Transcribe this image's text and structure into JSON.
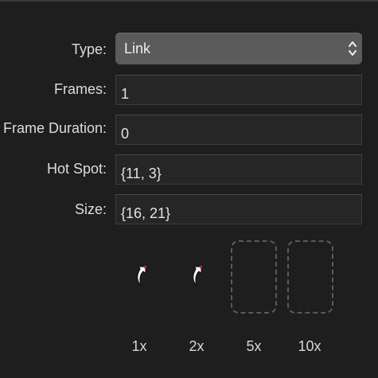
{
  "fields": {
    "type": {
      "label": "Type:",
      "value": "Link"
    },
    "frames": {
      "label": "Frames:",
      "value": "1"
    },
    "frame_duration": {
      "label": "Frame Duration:",
      "value": "0"
    },
    "hot_spot": {
      "label": "Hot Spot:",
      "value": "{11, 3}"
    },
    "size": {
      "label": "Size:",
      "value": "{16, 21}"
    }
  },
  "previews": [
    {
      "scale": "1x",
      "icon": "link-cursor-icon",
      "filled": true
    },
    {
      "scale": "2x",
      "icon": "link-cursor-icon",
      "filled": true
    },
    {
      "scale": "5x",
      "icon": "empty-slot",
      "filled": false
    },
    {
      "scale": "10x",
      "icon": "empty-slot",
      "filled": false
    }
  ],
  "colors": {
    "background": "#1e1e1e",
    "field_background": "#262626",
    "select_background": "#5b5b5b",
    "hotspot_marker": "#d0202a"
  }
}
